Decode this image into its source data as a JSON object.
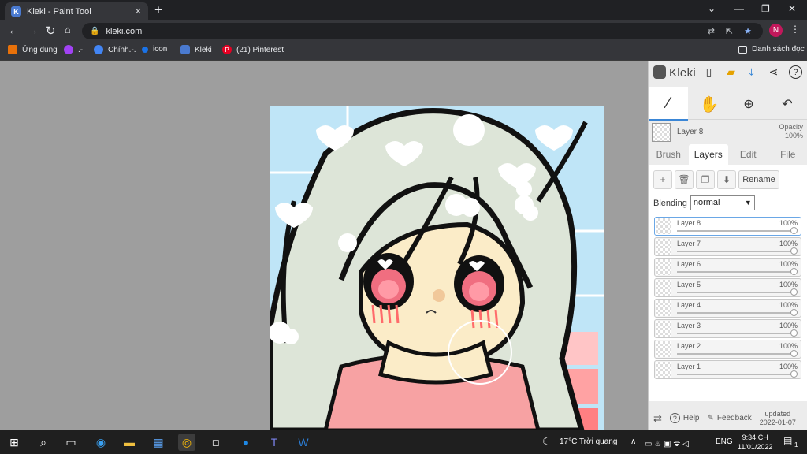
{
  "browser": {
    "tab": {
      "title": "Kleki - Paint Tool",
      "favicon": "K",
      "close": "✕"
    },
    "new_tab": "+",
    "window_controls": {
      "min": "⌄",
      "minimize": "—",
      "restore": "❐",
      "close": "✕"
    },
    "url": "kleki.com",
    "profile_initial": "N",
    "bookmarks": [
      {
        "label": "Ứng dụng",
        "icon": "apps-grid-icon",
        "color": "#e8710a"
      },
      {
        "label": ".-.",
        "icon": "circle-icon",
        "color": "#a142f4"
      },
      {
        "label": "Chính.-.",
        "icon": "atom-icon",
        "color": "#4285f4"
      },
      {
        "label": "icon",
        "icon": "dot-icon",
        "color": "#1a73e8"
      },
      {
        "label": "Kleki",
        "icon": "kleki-icon",
        "color": "#4a7ad0"
      },
      {
        "label": "(21) Pinterest",
        "icon": "pinterest-icon",
        "color": "#e60023"
      }
    ],
    "reading_list": "Danh sách đọc"
  },
  "app": {
    "logo": "Kleki",
    "current_layer": {
      "name": "Layer 8",
      "opacity_label": "Opacity",
      "opacity": "100%"
    },
    "tabs": [
      {
        "label": "Brush",
        "active": false
      },
      {
        "label": "Layers",
        "active": true
      },
      {
        "label": "Edit",
        "active": false
      },
      {
        "label": "File",
        "active": false
      }
    ],
    "rename": "Rename",
    "blending_label": "Blending",
    "blending_value": "normal",
    "layers": [
      {
        "name": "Layer 8",
        "opacity": "100%",
        "active": true
      },
      {
        "name": "Layer 7",
        "opacity": "100%",
        "active": false
      },
      {
        "name": "Layer 6",
        "opacity": "100%",
        "active": false
      },
      {
        "name": "Layer 5",
        "opacity": "100%",
        "active": false
      },
      {
        "name": "Layer 4",
        "opacity": "100%",
        "active": false
      },
      {
        "name": "Layer 3",
        "opacity": "100%",
        "active": false
      },
      {
        "name": "Layer 2",
        "opacity": "100%",
        "active": false
      },
      {
        "name": "Layer 1",
        "opacity": "100%",
        "active": false
      }
    ],
    "footer": {
      "help": "Help",
      "feedback": "Feedback",
      "updated": "updated",
      "date": "2022-01-07"
    }
  },
  "taskbar": {
    "weather": "17°C  Trời quang",
    "lang": "ENG",
    "time": "9:34 CH",
    "date": "11/01/2022",
    "notif": "1"
  }
}
